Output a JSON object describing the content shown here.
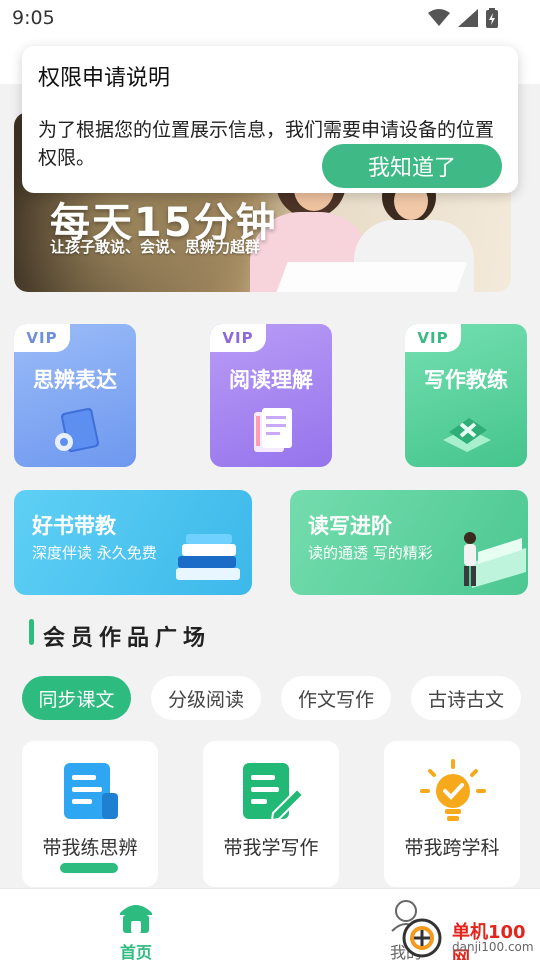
{
  "status_bar": {
    "time": "9:05",
    "icons": [
      "wifi-icon",
      "signal-icon",
      "battery-icon"
    ]
  },
  "dialog": {
    "title": "权限申请说明",
    "message": "为了根据您的位置展示信息，我们需要申请设备的位置权限。",
    "confirm_label": "我知道了"
  },
  "banner": {
    "title": "每天15分钟",
    "subtitle": "让孩子敢说、会说、思辨力超群"
  },
  "vip_cards": [
    {
      "tag": "VIP",
      "label": "思辨表达",
      "color": "#7fa8f3",
      "tag_color": "#6f8fdd"
    },
    {
      "tag": "VIP",
      "label": "阅读理解",
      "color": "#a785f2",
      "tag_color": "#8d69de"
    },
    {
      "tag": "VIP",
      "label": "写作教练",
      "color": "#5fd3a2",
      "tag_color": "#39b983"
    }
  ],
  "feature_cards": [
    {
      "title": "好书带教",
      "subtitle": "深度伴读 永久免费",
      "color": "#47c4ef"
    },
    {
      "title": "读写进阶",
      "subtitle": "读的通透 写的精彩",
      "color": "#62d29f"
    }
  ],
  "section": {
    "title": "会员作品广场"
  },
  "tabs": [
    {
      "label": "同步课文",
      "active": true
    },
    {
      "label": "分级阅读",
      "active": false
    },
    {
      "label": "作文写作",
      "active": false
    },
    {
      "label": "古诗古文",
      "active": false
    }
  ],
  "tiles": [
    {
      "label": "带我练思辨",
      "icon": "document-icon"
    },
    {
      "label": "带我学写作",
      "icon": "edit-document-icon"
    },
    {
      "label": "带我跨学科",
      "icon": "lightbulb-icon"
    }
  ],
  "bottom_nav": {
    "home": "首页",
    "me": "我的"
  },
  "watermark": {
    "line1": "单机100网",
    "line2": "danji100.com"
  }
}
